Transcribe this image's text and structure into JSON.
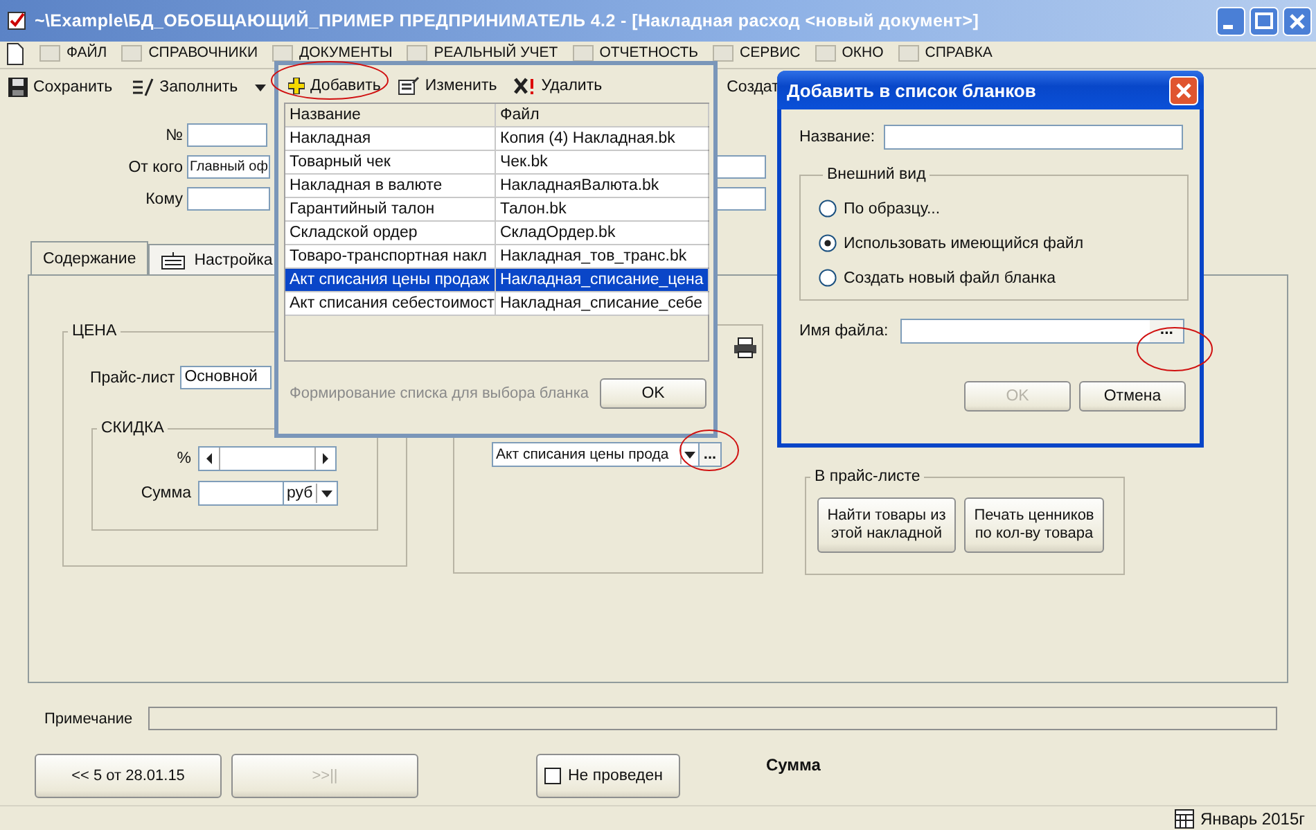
{
  "window": {
    "title": "~\\Example\\БД_ОБОБЩАЮЩИЙ_ПРИМЕР  ПРЕДПРИНИМАТЕЛЬ 4.2 - [Накладная расход <новый документ>]"
  },
  "menu": [
    "ФАЙЛ",
    "СПРАВОЧНИКИ",
    "ДОКУМЕНТЫ",
    "РЕАЛЬНЫЙ УЧЕТ",
    "ОТЧЕТНОСТЬ",
    "СЕРВИС",
    "ОКНО",
    "СПРАВКА"
  ],
  "toolbar": {
    "save": "Сохранить",
    "fill": "Заполнить",
    "create": "Создат"
  },
  "header_fields": [
    {
      "label": "№"
    },
    {
      "label": "От кого",
      "value": "Главный оф"
    },
    {
      "label": "Кому"
    }
  ],
  "tabs": [
    {
      "label": "Содержание",
      "selected": true
    },
    {
      "label": "Настройка",
      "selected": false
    }
  ],
  "price_group": {
    "title": "ЦЕНА",
    "price_list_label": "Прайс-лист",
    "price_list_value": "Основной",
    "discount": {
      "title": "СКИДКА",
      "percent_label": "%",
      "sum_label": "Сумма",
      "currency": "руб"
    }
  },
  "blank_select": {
    "value": "Акт списания цены прода",
    "browse": "..."
  },
  "pricelist_group": {
    "title": "В прайс-листе",
    "buttons": [
      "Найти товары из этой накладной",
      "Печать ценников по кол-ву товара"
    ]
  },
  "note": {
    "label": "Примечание"
  },
  "nav": {
    "prev": "<< 5 от 28.01.15",
    "next": ">>||",
    "next_disabled": true
  },
  "posted": {
    "label": "Не проведен",
    "checked": false
  },
  "sum_label": "Сумма",
  "status": "Январь 2015г",
  "blanks_dialog": {
    "toolbar": [
      "Добавить",
      "Изменить",
      "Удалить"
    ],
    "columns": [
      "Название",
      "Файл"
    ],
    "rows": [
      {
        "name": "Накладная",
        "file": "Копия (4) Накладная.bk",
        "selected": false
      },
      {
        "name": "Товарный чек",
        "file": "Чек.bk",
        "selected": false
      },
      {
        "name": "Накладная в валюте",
        "file": "НакладнаяВалюта.bk",
        "selected": false
      },
      {
        "name": "Гарантийный талон",
        "file": "Талон.bk",
        "selected": false
      },
      {
        "name": "Складской ордер",
        "file": "СкладОрдер.bk",
        "selected": false
      },
      {
        "name": "Товаро-транспортная накл",
        "file": "Накладная_тов_транс.bk",
        "selected": false
      },
      {
        "name": "Акт списания цены продаж",
        "file": "Накладная_списание_цена",
        "selected": true
      },
      {
        "name": "Акт списания себестоимост",
        "file": "Накладная_списание_себе",
        "selected": false
      }
    ],
    "hint": "Формирование списка для выбора бланка",
    "ok": "OK"
  },
  "add_dialog": {
    "title": "Добавить в список бланков",
    "name_label": "Название:",
    "appearance": {
      "title": "Внешний вид",
      "options": [
        {
          "label": "По образцу...",
          "selected": false
        },
        {
          "label": "Использовать имеющийся файл",
          "selected": true
        },
        {
          "label": "Создать новый файл бланка",
          "selected": false
        }
      ]
    },
    "file_label": "Имя файла:",
    "browse": "...",
    "ok": {
      "label": "OK",
      "disabled": true
    },
    "cancel": "Отмена"
  }
}
